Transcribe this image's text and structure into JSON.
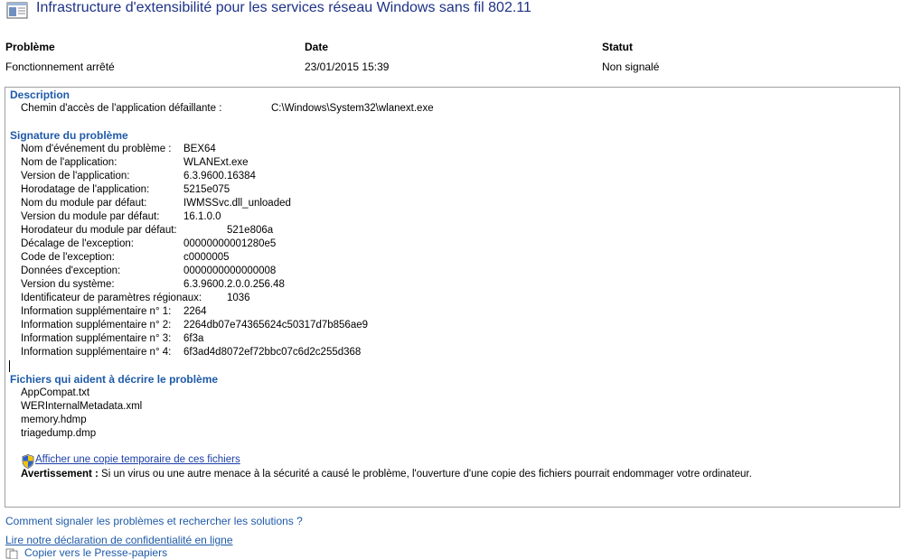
{
  "window": {
    "title": "Infrastructure d'extensibilité pour les services réseau Windows sans fil 802.11",
    "icon": "report-icon"
  },
  "summary": {
    "problem_header": "Problème",
    "problem_value": "Fonctionnement arrêté",
    "date_header": "Date",
    "date_value": "23/01/2015 15:39",
    "status_header": "Statut",
    "status_value": "Non signalé"
  },
  "description": {
    "title": "Description",
    "path_label": "Chemin d'accès de l'application défaillante :",
    "path_value": "C:\\Windows\\System32\\wlanext.exe"
  },
  "signature": {
    "title": "Signature du problème",
    "rows": [
      {
        "label": "Nom d'événement du problème :",
        "value": "BEX64"
      },
      {
        "label": "Nom de l'application:",
        "value": "WLANExt.exe"
      },
      {
        "label": "Version de l'application:",
        "value": "6.3.9600.16384"
      },
      {
        "label": "Horodatage de l'application:",
        "value": "5215e075"
      },
      {
        "label": "Nom du module par défaut:",
        "value": "IWMSSvc.dll_unloaded"
      },
      {
        "label": "Version du module par défaut:",
        "value": "16.1.0.0"
      },
      {
        "label": "Horodateur du module par défaut:",
        "value": "521e806a"
      },
      {
        "label": "Décalage de l'exception:",
        "value": "00000000001280e5"
      },
      {
        "label": "Code de l'exception:",
        "value": "c0000005"
      },
      {
        "label": "Données d'exception:",
        "value": "0000000000000008"
      },
      {
        "label": "Version du système:",
        "value": "6.3.9600.2.0.0.256.48"
      },
      {
        "label": "Identificateur de paramètres régionaux:",
        "value": "1036"
      },
      {
        "label": "Information supplémentaire n° 1:",
        "value": "2264"
      },
      {
        "label": "Information supplémentaire n° 2:",
        "value": "2264db07e74365624c50317d7b856ae9"
      },
      {
        "label": "Information supplémentaire n° 3:",
        "value": "6f3a"
      },
      {
        "label": "Information supplémentaire n° 4:",
        "value": "6f3ad4d8072ef72bbc07c6d2c255d368"
      }
    ]
  },
  "files": {
    "title": "Fichiers qui aident à décrire le problème",
    "items": [
      "AppCompat.txt",
      "WERInternalMetadata.xml",
      "memory.hdmp",
      "triagedump.dmp"
    ],
    "view_copy_link": "Afficher une copie temporaire de ces fichiers",
    "warning_bold": "Avertissement :",
    "warning_text": " Si un virus ou une autre menace à la sécurité a causé le problème, l'ouverture d'une copie des fichiers pourrait endommager votre ordinateur."
  },
  "footer": {
    "report_link": "Comment signaler les problèmes et rechercher les solutions ?",
    "privacy_link": "Lire notre déclaration de confidentialité en ligne",
    "copy_link": "Copier vers le Presse-papiers"
  }
}
